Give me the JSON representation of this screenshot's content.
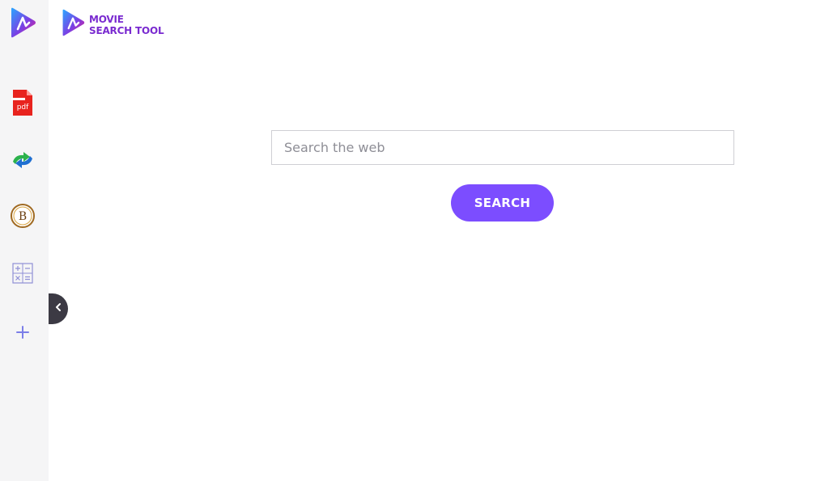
{
  "brand": {
    "line1": "MOVIE",
    "line2": "SEARCH TOOL",
    "logo_icon": "play-logo-icon"
  },
  "sidebar": {
    "items": [
      {
        "name": "movie-search-logo",
        "icon": "play-logo-icon"
      },
      {
        "name": "pdf-tool",
        "icon": "pdf-icon",
        "label": "pdf"
      },
      {
        "name": "converter-tool",
        "icon": "sync-arrows-icon"
      },
      {
        "name": "bitcoin-tool",
        "icon": "bitcoin-icon",
        "label": "B"
      },
      {
        "name": "calculator-tool",
        "icon": "calculator-icon"
      },
      {
        "name": "add-shortcut",
        "icon": "plus-icon"
      }
    ],
    "collapse_icon": "chevron-left-icon"
  },
  "search": {
    "placeholder": "Search the web",
    "value": "",
    "button_label": "SEARCH"
  },
  "colors": {
    "accent": "#7c4dff",
    "brand_text": "#7a2bd0",
    "sidebar_bg": "#f5f5f6"
  }
}
